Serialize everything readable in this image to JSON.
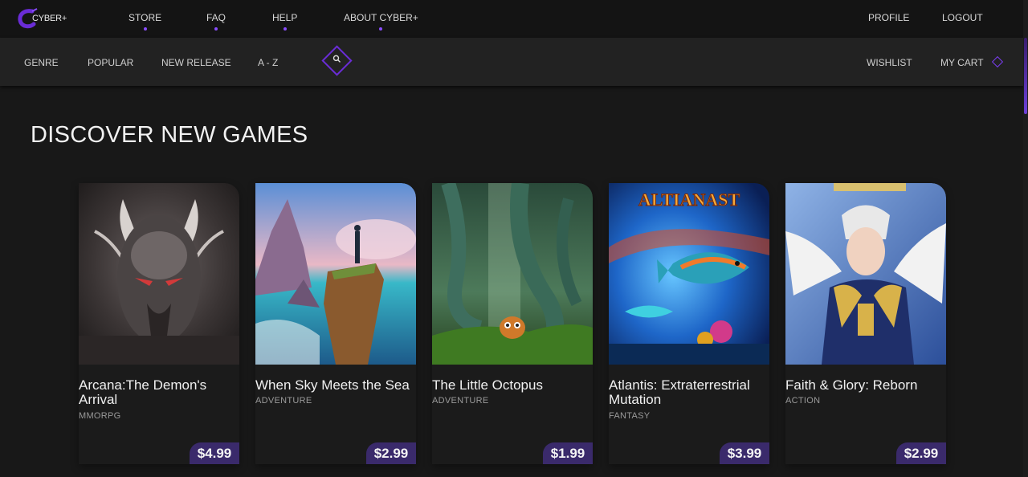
{
  "brand": {
    "logo_text": "CYBER+"
  },
  "top_nav": {
    "store": "STORE",
    "faq": "FAQ",
    "help": "HELP",
    "about": "ABOUT CYBER+",
    "profile": "PROFILE",
    "logout": "LOGOUT"
  },
  "sub_nav": {
    "genre": "GENRE",
    "popular": "POPULAR",
    "new_release": "NEW RELEASE",
    "a_z": "A - Z",
    "wishlist": "WISHLIST",
    "my_cart": "MY CART"
  },
  "colors": {
    "accent": "#6a2cd6",
    "price_badge": "#3a2a6b",
    "background": "#181818"
  },
  "main": {
    "title": "DISCOVER NEW GAMES",
    "games": [
      {
        "title": "Arcana:The Demon's Arrival",
        "genre": "MMORPG",
        "price": "$4.99",
        "image": "demon-mask-art"
      },
      {
        "title": "When Sky Meets the Sea",
        "genre": "ADVENTURE",
        "price": "$2.99",
        "image": "cliff-seascape-art"
      },
      {
        "title": "The Little Octopus",
        "genre": "ADVENTURE",
        "price": "$1.99",
        "image": "octopus-forest-art"
      },
      {
        "title": "Atlantis: Extraterrestrial Mutation",
        "genre": "FANTASY",
        "price": "$3.99",
        "image": "atlantis-fish-art",
        "image_text": "ALTIANAST"
      },
      {
        "title": "Faith & Glory: Reborn",
        "genre": "ACTION",
        "price": "$2.99",
        "image": "winged-knight-art"
      }
    ]
  }
}
